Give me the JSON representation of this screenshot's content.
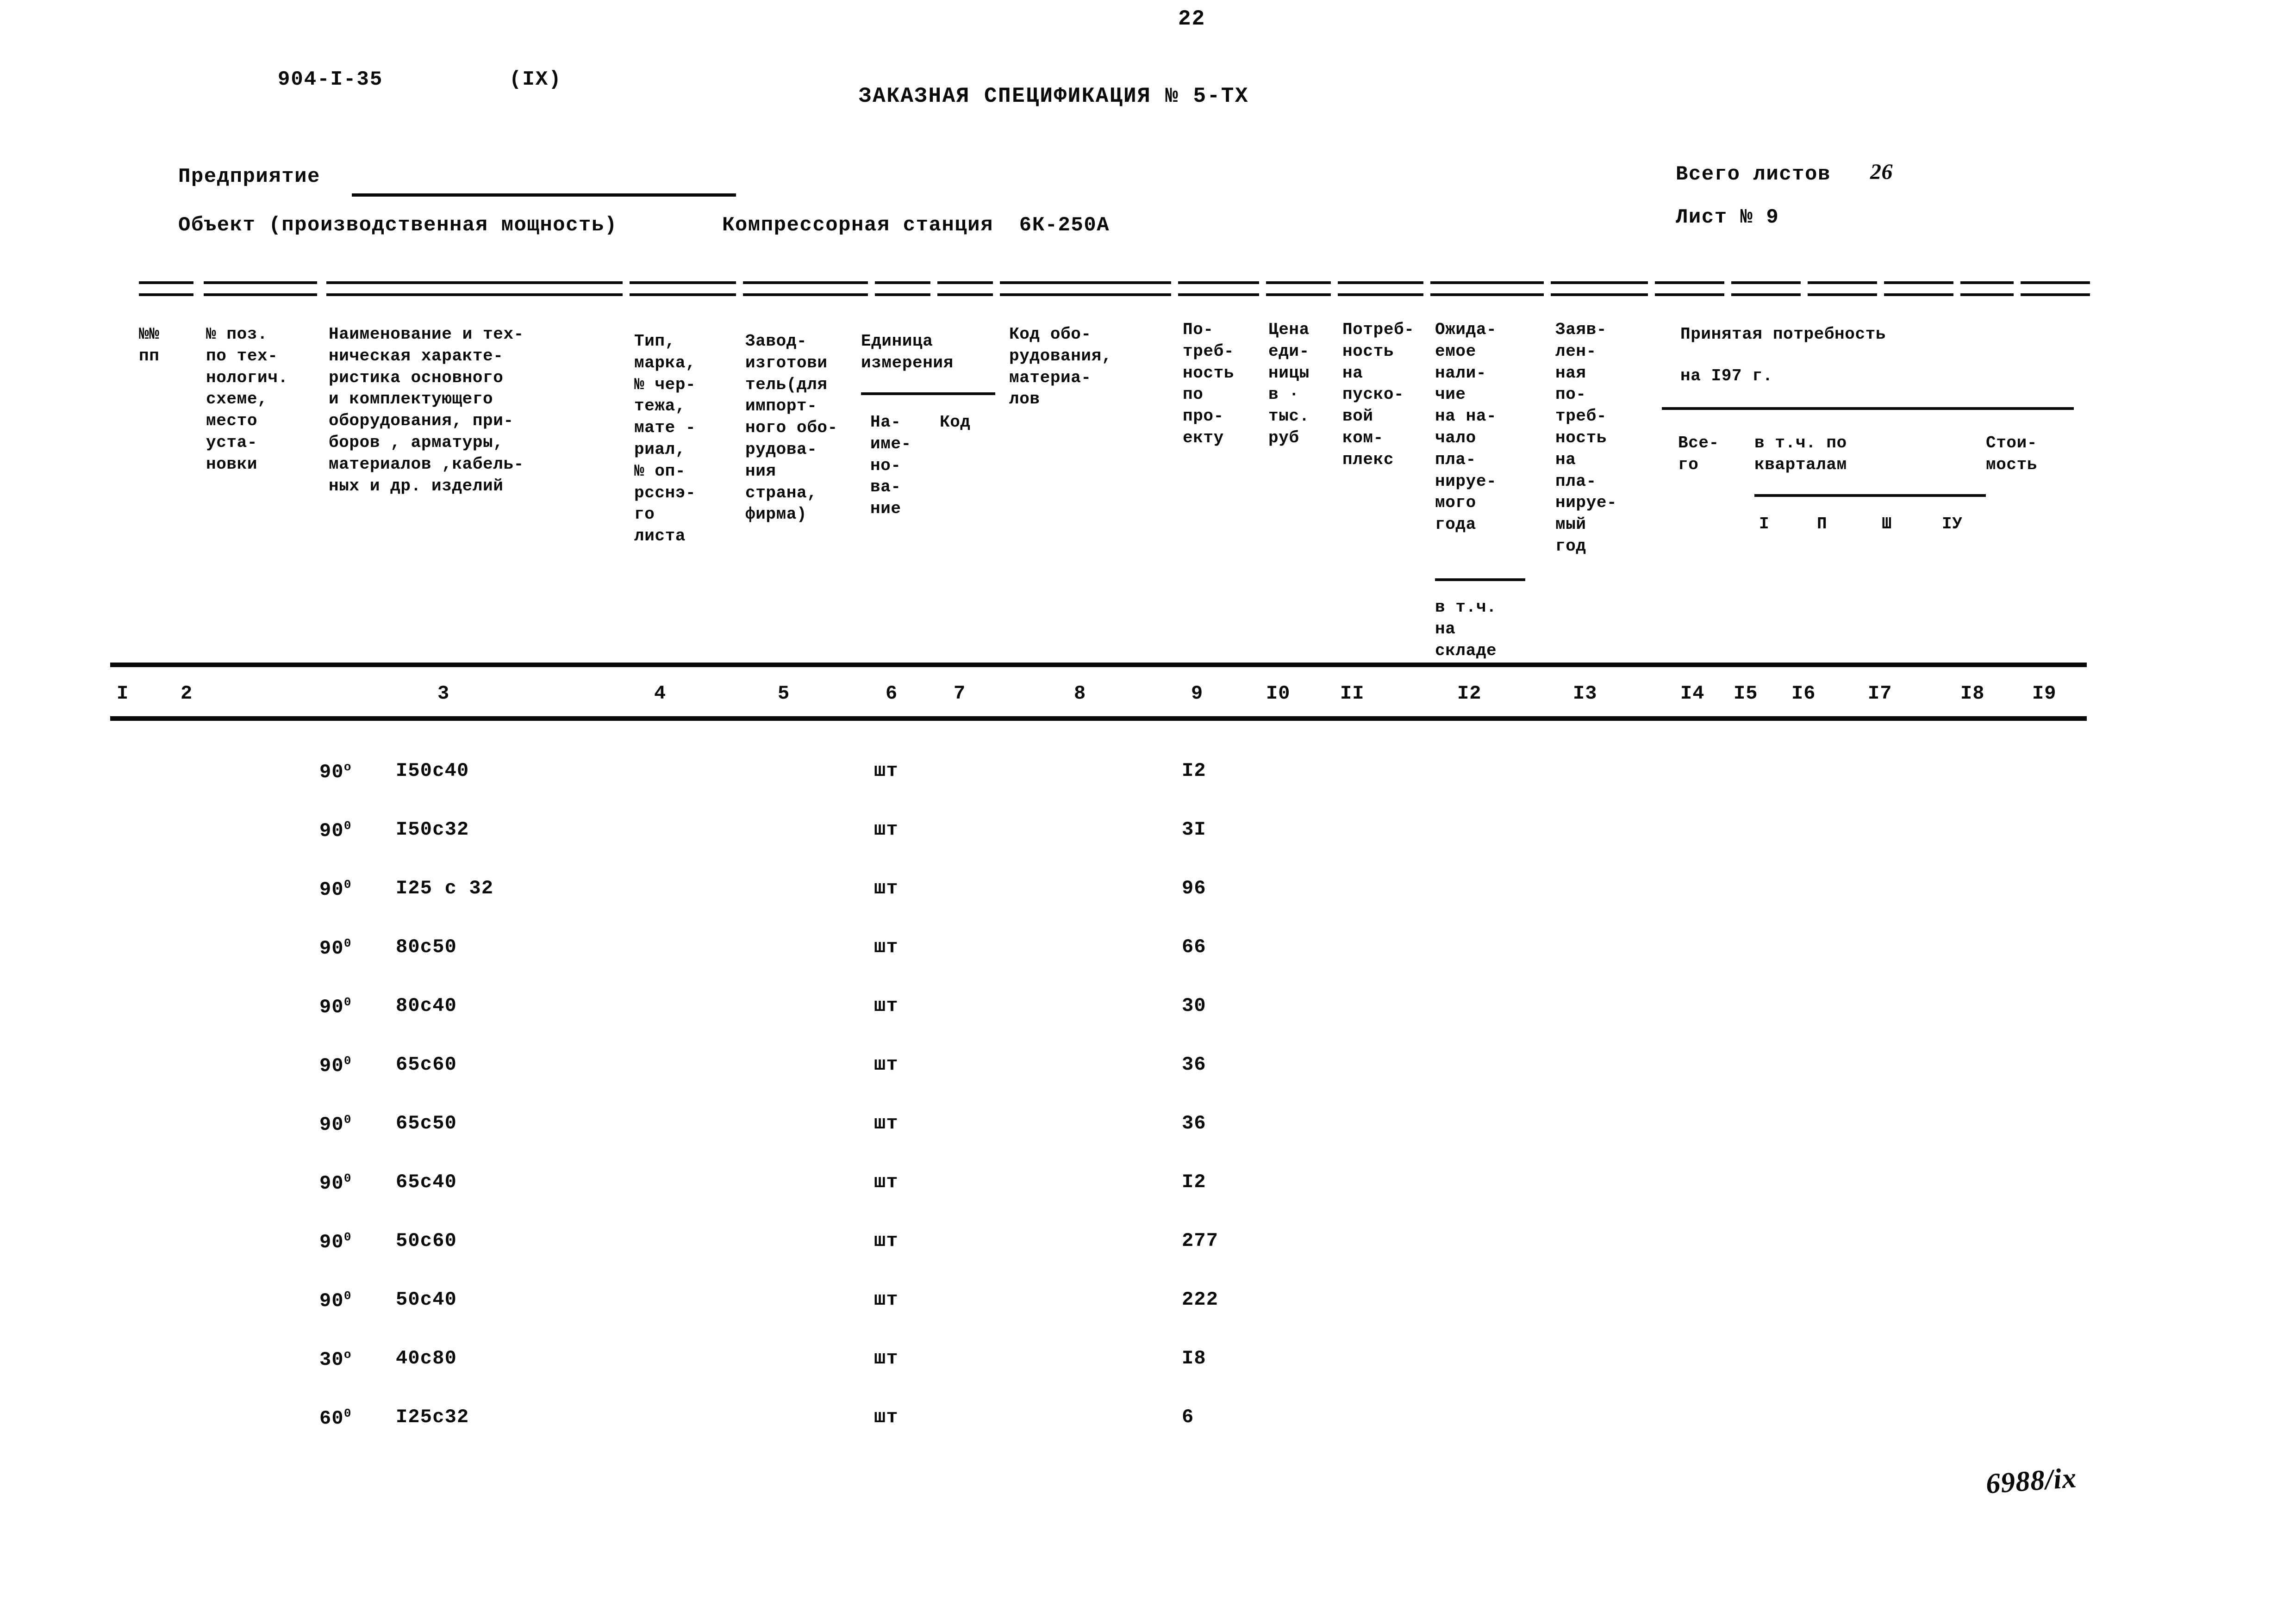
{
  "page": {
    "page_number": "22",
    "doc_code": "904-I-35",
    "doc_section": "(IX)",
    "title": "ЗАКАЗНАЯ СПЕЦИФИКАЦИЯ № 5-ТХ",
    "hand_mark": "6988/ix"
  },
  "fields": {
    "enterprise_label": "Предприятие",
    "enterprise_value": "",
    "object_label": "Объект (производственная мощность)",
    "object_value": "Компрессорная станция  6К-250А",
    "total_sheets_label": "Всего листов",
    "total_sheets_value": "26",
    "sheet_no_label": "Лист № 9"
  },
  "table": {
    "headers": [
      "№№\nпп",
      "№ поз.\nпо тех-\nнологич.\nсхеме,\nместо\nуста-\nновки",
      "Наименование и тех-\nническая характе-\nристика основного\nи комплектующего\nоборудования, при-\nборов , арматуры,\nматериалов ,кабель-\nных и др. изделий",
      "Тип,\nмарка,\n№ чер-\nтежа,\nмате -\nриал,\n№ оп-\nрсснэ-\nго\nлиста",
      "Завод-\nизготови\nтель(для\nимпорт-\nного обо-\nрудова-\nния\nстрана,\nфирма)",
      "Единица\nизмерения",
      "На-\nиме-\nно-\nва-\nние",
      "Код",
      "Код обо-\nрудования,\nматериа-\nлов",
      "По-\nтреб-\nность\nпо\nпро-\nекту",
      "Цена\nеди-\nницы\nв ·\nтыс.\nруб",
      "Потреб-\nность\nна\nпуско-\nвой\nком-\nплекс",
      "Ожида-\nемое\nнали-\nчие\nна на-\nчало\nпла-\nнируе-\nмого\nгода",
      "в т.ч.\nна\nскладе",
      "Заяв-\nлен-\nная\nпо-\nтреб-\nность\nна\nпла-\nнируе-\nмый\nгод",
      "Принятая  потребность",
      "на I97            г.",
      "Все-\nго",
      "в т.ч. по\nкварталам",
      "Стои-\nмость",
      "I",
      "П",
      "Ш",
      "IУ"
    ],
    "column_numbers": [
      "I",
      "2",
      "3",
      "4",
      "5",
      "6",
      "7",
      "8",
      "9",
      "I0",
      "II",
      "I2",
      "I3",
      "I4",
      "I5",
      "I6",
      "I7",
      "I8",
      "I9"
    ],
    "rows": [
      {
        "angle": "90",
        "deg": "o",
        "name": "I50c40",
        "unit": "шт",
        "qty": "I2"
      },
      {
        "angle": "90",
        "deg": "0",
        "name": "I50c32",
        "unit": "шт",
        "qty": "3I"
      },
      {
        "angle": "90",
        "deg": "0",
        "name": "I25 c 32",
        "unit": "шт",
        "qty": "96"
      },
      {
        "angle": "90",
        "deg": "0",
        "name": "80c50",
        "unit": "шт",
        "qty": "66"
      },
      {
        "angle": "90",
        "deg": "0",
        "name": "80c40",
        "unit": "шт",
        "qty": "30"
      },
      {
        "angle": "90",
        "deg": "0",
        "name": "65c60",
        "unit": "шт",
        "qty": "36"
      },
      {
        "angle": "90",
        "deg": "0",
        "name": "65c50",
        "unit": "шт",
        "qty": "36"
      },
      {
        "angle": "90",
        "deg": "0",
        "name": "65c40",
        "unit": "шт",
        "qty": "I2"
      },
      {
        "angle": "90",
        "deg": "0",
        "name": "50c60",
        "unit": "шт",
        "qty": "277"
      },
      {
        "angle": "90",
        "deg": "0",
        "name": "50c40",
        "unit": "шт",
        "qty": "222"
      },
      {
        "angle": "30",
        "deg": "o",
        "name": "40c80",
        "unit": "шт",
        "qty": "I8"
      },
      {
        "angle": "60",
        "deg": "0",
        "name": "I25c32",
        "unit": "шт",
        "qty": "6"
      }
    ]
  }
}
